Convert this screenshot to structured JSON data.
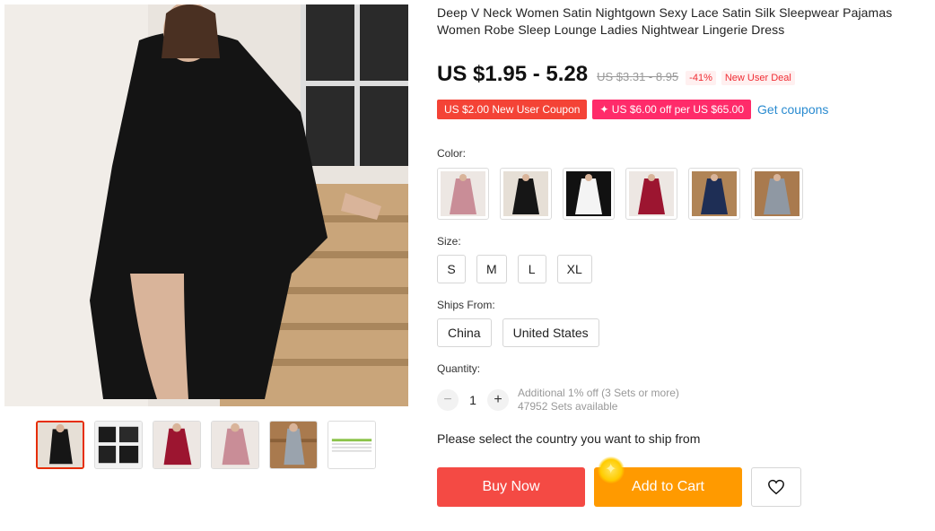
{
  "product": {
    "title": "Deep V Neck Women Satin Nightgown Sexy Lace Satin Silk Sleepwear Pajamas Women Robe Sleep Lounge Ladies Nightwear Lingerie Dress",
    "price": "US $1.95 - 5.28",
    "original_price": "US $3.31 - 8.95",
    "discount": "-41%",
    "deal_badge": "New User Deal"
  },
  "coupons": {
    "new_user": "US $2.00 New User Coupon",
    "store": "✦ US $6.00 off per US $65.00",
    "get_coupons": "Get coupons"
  },
  "color": {
    "label": "Color:",
    "swatches": [
      "pink",
      "black",
      "white",
      "wine-red",
      "navy",
      "grey"
    ]
  },
  "size": {
    "label": "Size:",
    "options": [
      "S",
      "M",
      "L",
      "XL"
    ]
  },
  "ships_from": {
    "label": "Ships From:",
    "options": [
      "China",
      "United States"
    ]
  },
  "quantity": {
    "label": "Quantity:",
    "minus": "−",
    "value": "1",
    "plus": "+",
    "discount_note": "Additional 1% off (3 Sets or more)",
    "available": "47952 Sets available"
  },
  "ship_message": "Please select the country you want to ship from",
  "actions": {
    "buy_now": "Buy Now",
    "add_to_cart": "Add to Cart",
    "wishlist_icon": "heart-icon"
  },
  "colors": {
    "price_red": "#f02d34",
    "buy_now": "#f44a44",
    "add_to_cart": "#ff9a00",
    "coupon_red": "#f44336",
    "coupon_pink": "#ff2b6a",
    "link_blue": "#2a8bd0"
  }
}
